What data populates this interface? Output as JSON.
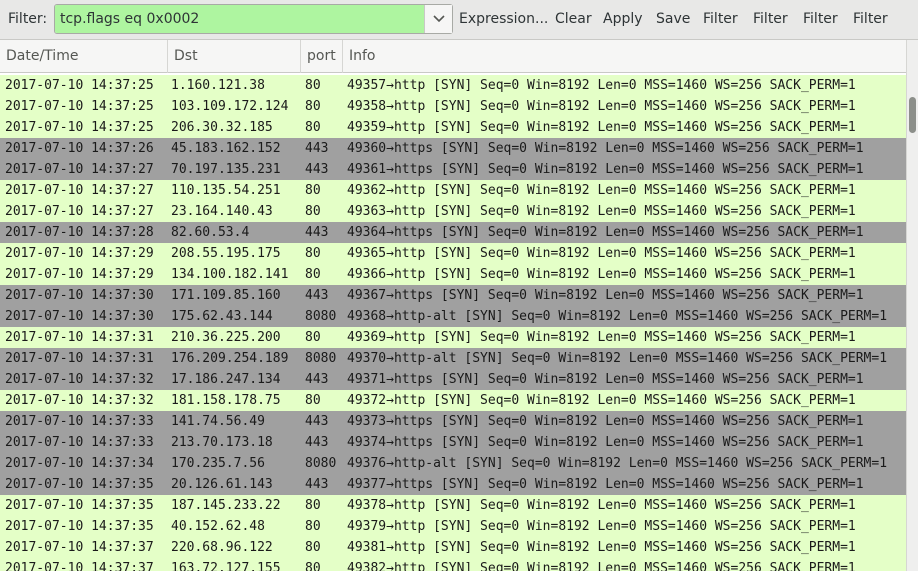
{
  "toolbar": {
    "filter_label": "Filter:",
    "filter_value": "tcp.flags eq 0x0002",
    "buttons": [
      "Expression...",
      "Clear",
      "Apply",
      "Save",
      "Filter",
      "Filter",
      "Filter",
      "Filter"
    ]
  },
  "columns": [
    "Date/Time",
    "Dst",
    "port",
    "Info"
  ],
  "colors": {
    "match": "#e4ffc7",
    "https": "#a0a0a0",
    "filter_ok": "#aef5a0"
  },
  "rows": [
    {
      "time": "2017-07-10 14:37:25",
      "dst": "1.160.121.38",
      "port": "80",
      "info": "49357→http [SYN] Seq=0 Win=8192 Len=0 MSS=1460 WS=256 SACK_PERM=1",
      "style": "green"
    },
    {
      "time": "2017-07-10 14:37:25",
      "dst": "103.109.172.124",
      "port": "80",
      "info": "49358→http [SYN] Seq=0 Win=8192 Len=0 MSS=1460 WS=256 SACK_PERM=1",
      "style": "green"
    },
    {
      "time": "2017-07-10 14:37:25",
      "dst": "206.30.32.185",
      "port": "80",
      "info": "49359→http [SYN] Seq=0 Win=8192 Len=0 MSS=1460 WS=256 SACK_PERM=1",
      "style": "green"
    },
    {
      "time": "2017-07-10 14:37:26",
      "dst": "45.183.162.152",
      "port": "443",
      "info": "49360→https [SYN] Seq=0 Win=8192 Len=0 MSS=1460 WS=256 SACK_PERM=1",
      "style": "gray"
    },
    {
      "time": "2017-07-10 14:37:27",
      "dst": "70.197.135.231",
      "port": "443",
      "info": "49361→https [SYN] Seq=0 Win=8192 Len=0 MSS=1460 WS=256 SACK_PERM=1",
      "style": "gray"
    },
    {
      "time": "2017-07-10 14:37:27",
      "dst": "110.135.54.251",
      "port": "80",
      "info": "49362→http [SYN] Seq=0 Win=8192 Len=0 MSS=1460 WS=256 SACK_PERM=1",
      "style": "green"
    },
    {
      "time": "2017-07-10 14:37:27",
      "dst": "23.164.140.43",
      "port": "80",
      "info": "49363→http [SYN] Seq=0 Win=8192 Len=0 MSS=1460 WS=256 SACK_PERM=1",
      "style": "green"
    },
    {
      "time": "2017-07-10 14:37:28",
      "dst": "82.60.53.4",
      "port": "443",
      "info": "49364→https [SYN] Seq=0 Win=8192 Len=0 MSS=1460 WS=256 SACK_PERM=1",
      "style": "gray"
    },
    {
      "time": "2017-07-10 14:37:29",
      "dst": "208.55.195.175",
      "port": "80",
      "info": "49365→http [SYN] Seq=0 Win=8192 Len=0 MSS=1460 WS=256 SACK_PERM=1",
      "style": "green"
    },
    {
      "time": "2017-07-10 14:37:29",
      "dst": "134.100.182.141",
      "port": "80",
      "info": "49366→http [SYN] Seq=0 Win=8192 Len=0 MSS=1460 WS=256 SACK_PERM=1",
      "style": "green"
    },
    {
      "time": "2017-07-10 14:37:30",
      "dst": "171.109.85.160",
      "port": "443",
      "info": "49367→https [SYN] Seq=0 Win=8192 Len=0 MSS=1460 WS=256 SACK_PERM=1",
      "style": "gray"
    },
    {
      "time": "2017-07-10 14:37:30",
      "dst": "175.62.43.144",
      "port": "8080",
      "info": "49368→http-alt [SYN] Seq=0 Win=8192 Len=0 MSS=1460 WS=256 SACK_PERM=1",
      "style": "gray"
    },
    {
      "time": "2017-07-10 14:37:31",
      "dst": "210.36.225.200",
      "port": "80",
      "info": "49369→http [SYN] Seq=0 Win=8192 Len=0 MSS=1460 WS=256 SACK_PERM=1",
      "style": "green"
    },
    {
      "time": "2017-07-10 14:37:31",
      "dst": "176.209.254.189",
      "port": "8080",
      "info": "49370→http-alt [SYN] Seq=0 Win=8192 Len=0 MSS=1460 WS=256 SACK_PERM=1",
      "style": "gray"
    },
    {
      "time": "2017-07-10 14:37:32",
      "dst": "17.186.247.134",
      "port": "443",
      "info": "49371→https [SYN] Seq=0 Win=8192 Len=0 MSS=1460 WS=256 SACK_PERM=1",
      "style": "gray"
    },
    {
      "time": "2017-07-10 14:37:32",
      "dst": "181.158.178.75",
      "port": "80",
      "info": "49372→http [SYN] Seq=0 Win=8192 Len=0 MSS=1460 WS=256 SACK_PERM=1",
      "style": "green"
    },
    {
      "time": "2017-07-10 14:37:33",
      "dst": "141.74.56.49",
      "port": "443",
      "info": "49373→https [SYN] Seq=0 Win=8192 Len=0 MSS=1460 WS=256 SACK_PERM=1",
      "style": "gray"
    },
    {
      "time": "2017-07-10 14:37:33",
      "dst": "213.70.173.18",
      "port": "443",
      "info": "49374→https [SYN] Seq=0 Win=8192 Len=0 MSS=1460 WS=256 SACK_PERM=1",
      "style": "gray"
    },
    {
      "time": "2017-07-10 14:37:34",
      "dst": "170.235.7.56",
      "port": "8080",
      "info": "49376→http-alt [SYN] Seq=0 Win=8192 Len=0 MSS=1460 WS=256 SACK_PERM=1",
      "style": "gray"
    },
    {
      "time": "2017-07-10 14:37:35",
      "dst": "20.126.61.143",
      "port": "443",
      "info": "49377→https [SYN] Seq=0 Win=8192 Len=0 MSS=1460 WS=256 SACK_PERM=1",
      "style": "gray"
    },
    {
      "time": "2017-07-10 14:37:35",
      "dst": "187.145.233.22",
      "port": "80",
      "info": "49378→http [SYN] Seq=0 Win=8192 Len=0 MSS=1460 WS=256 SACK_PERM=1",
      "style": "green"
    },
    {
      "time": "2017-07-10 14:37:35",
      "dst": "40.152.62.48",
      "port": "80",
      "info": "49379→http [SYN] Seq=0 Win=8192 Len=0 MSS=1460 WS=256 SACK_PERM=1",
      "style": "green"
    },
    {
      "time": "2017-07-10 14:37:37",
      "dst": "220.68.96.122",
      "port": "80",
      "info": "49381→http [SYN] Seq=0 Win=8192 Len=0 MSS=1460 WS=256 SACK_PERM=1",
      "style": "green"
    },
    {
      "time": "2017-07-10 14:37:37",
      "dst": "163.72.127.155",
      "port": "80",
      "info": "49382→http [SYN] Seq=0 Win=8192 Len=0 MSS=1460 WS=256 SACK_PERM=1",
      "style": "green"
    }
  ]
}
